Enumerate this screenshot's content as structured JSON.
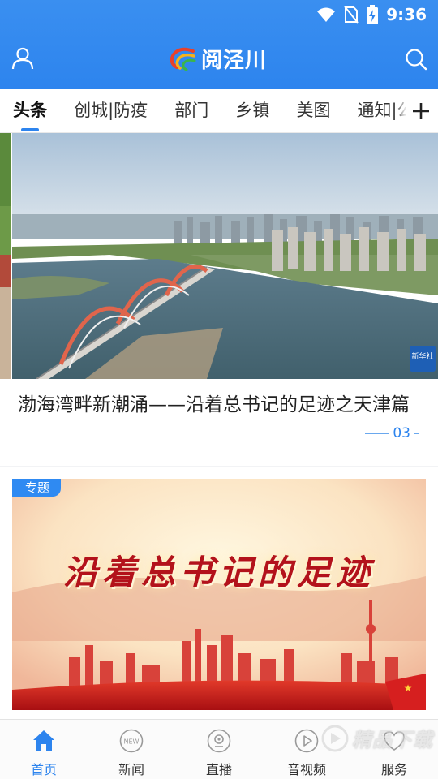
{
  "status_bar": {
    "time": "9:36"
  },
  "app": {
    "title": "阅泾川"
  },
  "tabs": [
    {
      "label": "头条",
      "active": true
    },
    {
      "label": "创城|防疫",
      "active": false
    },
    {
      "label": "部门",
      "active": false
    },
    {
      "label": "乡镇",
      "active": false
    },
    {
      "label": "美图",
      "active": false
    },
    {
      "label": "通知|公",
      "active": false
    }
  ],
  "tab_add_icon": "plus-icon",
  "carousel": {
    "caption": "渤海湾畔新潮涌——沿着总书记的足迹之天津篇",
    "index": "03",
    "photo_badge": "新华社"
  },
  "feature": {
    "tag": "专题",
    "title": "沿着总书记的足迹"
  },
  "bottom_nav": [
    {
      "label": "首页",
      "icon": "home-icon",
      "active": true
    },
    {
      "label": "新闻",
      "icon": "news-icon",
      "active": false
    },
    {
      "label": "直播",
      "icon": "live-icon",
      "active": false
    },
    {
      "label": "音视频",
      "icon": "play-icon",
      "active": false
    },
    {
      "label": "服务",
      "icon": "service-icon",
      "active": false
    }
  ],
  "watermark": {
    "text": "精品下载"
  },
  "colors": {
    "brand": "#2d84ee",
    "feature_title": "#b3121b"
  }
}
